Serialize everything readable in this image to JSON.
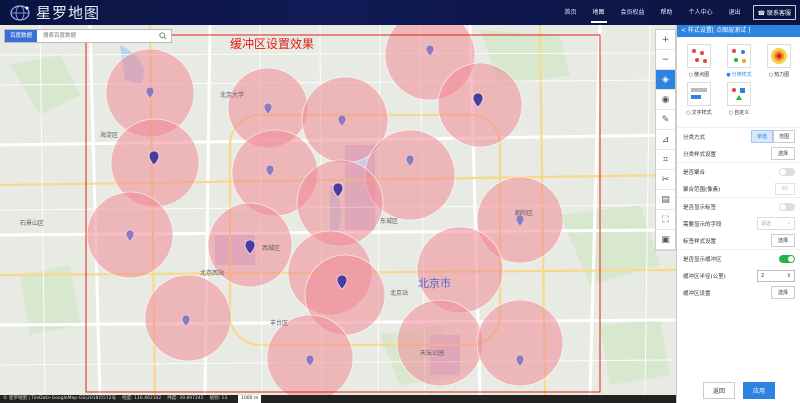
{
  "app": {
    "name": "星罗地图"
  },
  "nav": {
    "items": [
      "首页",
      "地图",
      "会员权益",
      "帮助",
      "个人中心",
      "退出"
    ],
    "active_index": 1,
    "contact": "联系客服"
  },
  "search": {
    "type": "百度数据",
    "placeholder": "搜索百度数据"
  },
  "map": {
    "demo_title": "缓冲区设置效果",
    "labels": [
      "北京大学",
      "海淀区",
      "北京市",
      "西城区",
      "东城区",
      "朝阳区",
      "丰台区",
      "石景山区",
      "北京西站",
      "天坛公园",
      "北京站"
    ],
    "toolbar": [
      "zoom-in",
      "zoom-out",
      "layers",
      "locate",
      "measure",
      "draw",
      "crop",
      "cut",
      "chart",
      "fullscreen",
      "export"
    ]
  },
  "status": {
    "credit": "© 星罗地图 | TileData-GoogleMap-GS(2018)5572号",
    "lng": "经度: 116.462102",
    "lat": "纬度: 39.897245",
    "zoom": "级别: 13",
    "scale": "1000 m"
  },
  "panel": {
    "title": "< 样式设置[ 点图层测试 ]",
    "styles": [
      {
        "label": "散点图",
        "selected": false
      },
      {
        "label": "分类样式",
        "selected": true
      },
      {
        "label": "热力图",
        "selected": false
      },
      {
        "label": "文字样式",
        "selected": false
      },
      {
        "label": "自定义",
        "selected": false
      }
    ],
    "classify_method": {
      "label": "分类方式",
      "options": [
        "单值",
        "范围"
      ],
      "selected": "单值"
    },
    "classify_style": {
      "label": "分类样式设置",
      "button": "选择"
    },
    "aggregate": {
      "label": "是否聚合",
      "on": false
    },
    "aggregate_range": {
      "label": "聚合范围(像素)",
      "value": "60"
    },
    "show_label": {
      "label": "是否显示标签",
      "on": false
    },
    "label_field": {
      "label": "需要显示的字段",
      "value": "请选"
    },
    "label_style": {
      "label": "标签样式设置",
      "button": "选择"
    },
    "buffer": {
      "label": "是否显示缓冲区",
      "on": true
    },
    "buffer_radius": {
      "label": "缓冲区半径(公里)",
      "value": "2"
    },
    "buffer_style": {
      "label": "缓冲区设置",
      "button": "选择"
    },
    "reset": "返回",
    "apply": "应用"
  },
  "colors": {
    "accent": "#2d83e0",
    "buffer": "#f08a96",
    "frame": "#e0201a",
    "pin": "#4b3aa0"
  }
}
